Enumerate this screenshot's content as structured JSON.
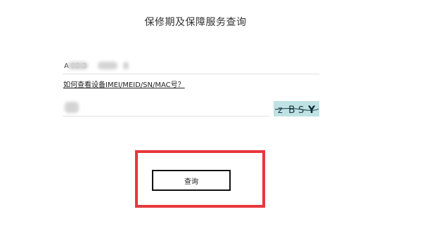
{
  "page": {
    "title": "保修期及保障服务查询"
  },
  "form": {
    "imei_value": "A 00 3",
    "help_link_text": "如何查看设备IMEI/MEID/SN/MAC号？",
    "captcha_value": "",
    "captcha_text": "zBSY"
  },
  "actions": {
    "query_label": "查询"
  },
  "colors": {
    "highlight": "#e8373d",
    "captcha_bg": "#bfe2e4"
  }
}
